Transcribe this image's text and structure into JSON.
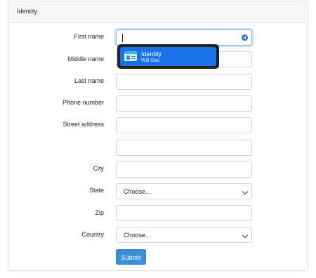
{
  "card": {
    "title": "Identity"
  },
  "fields": {
    "first_name": {
      "label": "First name",
      "value": ""
    },
    "middle_name": {
      "label": "Middle name",
      "value": ""
    },
    "last_name": {
      "label": "Last name",
      "value": ""
    },
    "phone_number": {
      "label": "Phone number",
      "value": ""
    },
    "street_address": {
      "label": "Street address",
      "value": "",
      "line2": ""
    },
    "city": {
      "label": "City",
      "value": ""
    },
    "state": {
      "label": "State",
      "selected": "Choose..."
    },
    "zip": {
      "label": "Zip",
      "value": ""
    },
    "country": {
      "label": "Country",
      "selected": "Choose..."
    }
  },
  "submit_label": "Submit",
  "autofill_popup": {
    "item_title": "Identity",
    "item_subtitle": "Will Gao",
    "icon": "id-card-icon",
    "accent_color": "#1a72e8"
  },
  "password_manager_icon": "password-manager-icon"
}
